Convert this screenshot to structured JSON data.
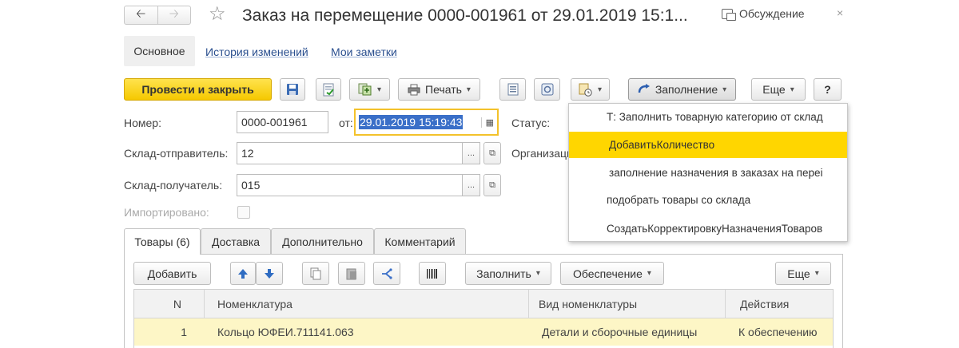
{
  "window": {
    "title": "Заказ на перемещение 0000-001961 от 29.01.2019 15:1...",
    "discussion_label": "Обсуждение",
    "back_icon": "arrow-left-icon",
    "forward_icon": "arrow-right-icon"
  },
  "nav_tabs": {
    "main": "Основное",
    "history": "История изменений",
    "notes": "Мои заметки"
  },
  "toolbar": {
    "post_close": "Провести и закрыть",
    "print": "Печать",
    "fill": "Заполнение",
    "more": "Еще",
    "help": "?"
  },
  "form": {
    "number_label": "Номер:",
    "number_value": "0000-001961",
    "from_label": "от:",
    "date_value": "29.01.2019 15:19:43",
    "status_label": "Статус:",
    "sender_label": "Склад-отправитель:",
    "sender_value": "12",
    "org_label": "Организаци",
    "receiver_label": "Склад-получатель:",
    "receiver_value": "015",
    "imported_label": "Импортировано:",
    "ellipsis": "...",
    "open_icon": "⧉"
  },
  "fill_menu": {
    "items": [
      "Т: Заполнить товарную категорию от склад",
      "ДобавитьКоличество",
      "заполнение назначения в заказах на переі",
      "подобрать товары со склада",
      "СоздатьКорректировкуНазначенияТоваров"
    ],
    "highlighted_index": 1
  },
  "detail_tabs": {
    "goods": "Товары (6)",
    "delivery": "Доставка",
    "additional": "Дополнительно",
    "comment": "Комментарий"
  },
  "table_toolbar": {
    "add": "Добавить",
    "fill": "Заполнить",
    "supply": "Обеспечение",
    "more": "Еще"
  },
  "table": {
    "columns": [
      "N",
      "Номенклатура",
      "Вид номенклатуры",
      "Действия"
    ],
    "rows": [
      {
        "n": "1",
        "item": "Кольцо ЮФЕИ.711141.063",
        "kind": "Детали и сборочные единицы",
        "action": "К обеспечению"
      }
    ]
  },
  "colors": {
    "primary_button": "#f5c800",
    "menu_highlight": "#ffd600",
    "row_highlight": "#fdf6c6",
    "date_focus_border": "#f3c22b",
    "selection": "#3a6fc8",
    "link": "#2a4f8f"
  }
}
